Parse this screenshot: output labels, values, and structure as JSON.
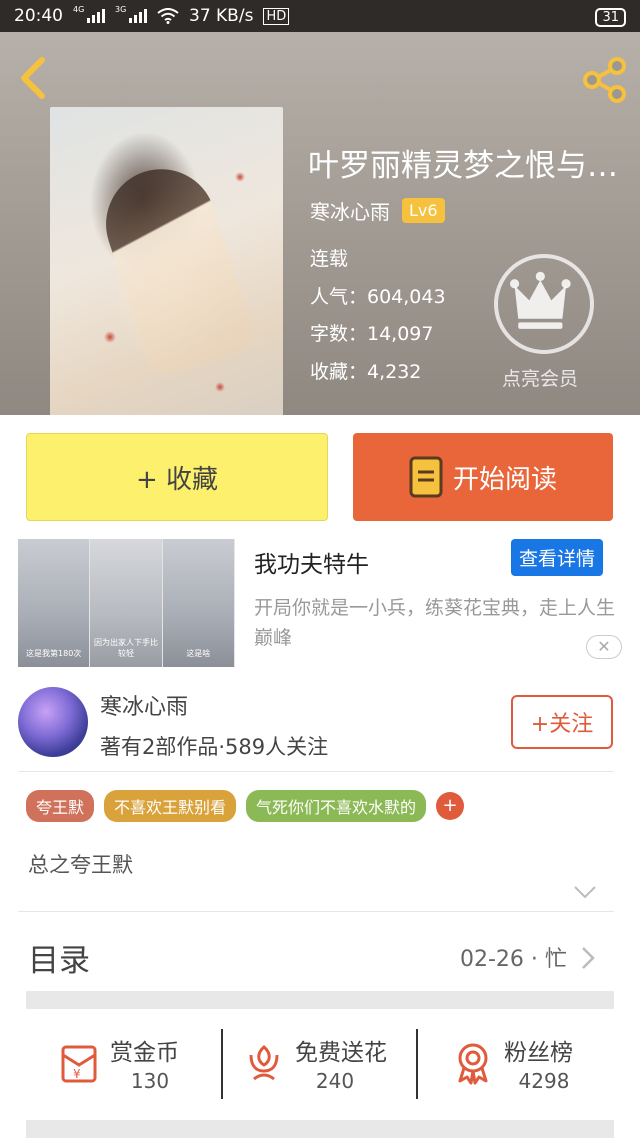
{
  "status_bar": {
    "time": "20:40",
    "net_4g": "4G",
    "net_3g": "3G",
    "speed": "37 KB/s",
    "hd": "HD",
    "battery": "31"
  },
  "book": {
    "title": "叶罗丽精灵梦之恨与不...",
    "author": "寒冰心雨",
    "level": "Lv6",
    "status": "连载",
    "popularity": "人气：604,043",
    "words": "字数：14,097",
    "favorites": "收藏：4,232",
    "vip_label": "点亮会员"
  },
  "actions": {
    "collect": "+ 收藏",
    "read": "开始阅读"
  },
  "ad": {
    "title": "我功夫特牛",
    "detail_button": "查看详情",
    "description": "开局你就是一小兵，练葵花宝典，走上人生巅峰",
    "panel_captions": [
      "这是我第180次",
      "因为出家人下手比较轻",
      "这是啥"
    ],
    "close": "✕"
  },
  "author_block": {
    "name": "寒冰心雨",
    "meta": "著有2部作品·589人关注",
    "follow": "+关注"
  },
  "tags": [
    {
      "label": "夸王默",
      "color": "#d0715c"
    },
    {
      "label": "不喜欢王默别看",
      "color": "#d9a23a"
    },
    {
      "label": "气死你们不喜欢水默的",
      "color": "#8bb955"
    }
  ],
  "tag_add": "+",
  "intro": "总之夸王默",
  "toc": {
    "title": "目录",
    "update": "02-26 · 忙"
  },
  "rewards": [
    {
      "label": "赏金币",
      "count": "130",
      "icon": "red-envelope-icon"
    },
    {
      "label": "免费送花",
      "count": "240",
      "icon": "flower-icon"
    },
    {
      "label": "粉丝榜",
      "count": "4298",
      "icon": "medal-icon"
    }
  ],
  "colors": {
    "accent": "#e05a3c",
    "collect_bg": "#fdf06d",
    "read_bg": "#e8663a",
    "detail_blue": "#1976e5",
    "level_badge": "#f6c13c"
  }
}
